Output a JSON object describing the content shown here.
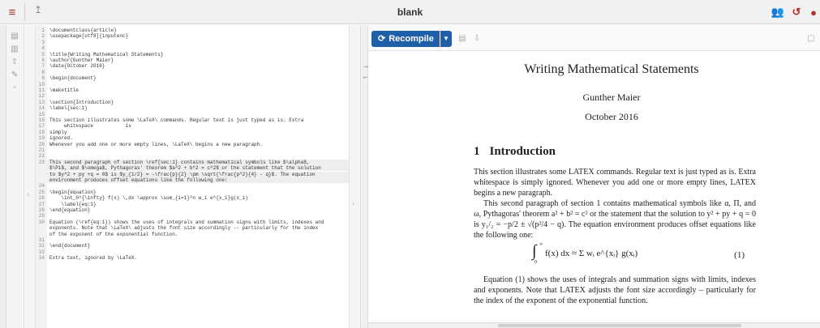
{
  "window": {
    "title": "blank"
  },
  "toolbar": {
    "recompile_label": "Recompile"
  },
  "editor": {
    "lines": [
      {
        "n": "1",
        "text": "\\documentclass{article}"
      },
      {
        "n": "2",
        "text": "\\usepackage[utf8]{inputenc}"
      },
      {
        "n": "3",
        "text": ""
      },
      {
        "n": "4",
        "text": ""
      },
      {
        "n": "5",
        "text": "\\title{Writing Mathematical Statements}"
      },
      {
        "n": "6",
        "text": "\\author{Gunther Maier}"
      },
      {
        "n": "7",
        "text": "\\date{October 2016}"
      },
      {
        "n": "8",
        "text": ""
      },
      {
        "n": "9",
        "text": "\\begin{document}"
      },
      {
        "n": "10",
        "text": ""
      },
      {
        "n": "11",
        "text": "\\maketitle"
      },
      {
        "n": "12",
        "text": ""
      },
      {
        "n": "13",
        "text": "\\section{Introduction}"
      },
      {
        "n": "14",
        "text": "\\label{sec:1}"
      },
      {
        "n": "15",
        "text": ""
      },
      {
        "n": "16",
        "text": "This section illustrates some \\LaTeX\\ commands. Regular text is just typed as is. Extra"
      },
      {
        "n": "17",
        "text": "     whitespace           is"
      },
      {
        "n": "18",
        "text": "simply"
      },
      {
        "n": "19",
        "text": "ignored."
      },
      {
        "n": "20",
        "text": "Whenever you add one or more empty lines, \\LaTeX\\ begins a new paragraph."
      },
      {
        "n": "21",
        "text": ""
      },
      {
        "n": "22",
        "text": ""
      },
      {
        "n": "23",
        "text": "This second paragraph of section \\ref{sec:1} contains mathematical symbols like $\\alpha$,"
      },
      {
        "n": "",
        "text": "$\\Pi$, and $\\omega$, Pythagoras' theorem $a^2 + b^2 = c^2$ or the statement that the solution"
      },
      {
        "n": "",
        "text": "to $y^2 + py +q = 0$ is $y_{1/2} = -\\frac{p}{2} \\pm \\sqrt{\\frac{p^2}{4} - q}$. The equation"
      },
      {
        "n": "",
        "text": "environment produces offset equations like the following one:"
      },
      {
        "n": "24",
        "text": ""
      },
      {
        "n": "25",
        "text": "\\begin{equation}"
      },
      {
        "n": "26",
        "text": "    \\int_0^{\\infty} f(x) \\,dx \\approx \\sum_{i=1}^n w_i e^{x_i}g(x_i)"
      },
      {
        "n": "27",
        "text": "    \\label{eq:1}"
      },
      {
        "n": "28",
        "text": "\\end{equation}"
      },
      {
        "n": "29",
        "text": ""
      },
      {
        "n": "30",
        "text": "Equation (\\ref{eq:1}) shows the uses of integrals and summation signs with limits, indexes and"
      },
      {
        "n": "",
        "text": "exponents. Note that \\LaTeX\\ adjusts the font size accordingly -- particularly for the index"
      },
      {
        "n": "",
        "text": "of the exponent of the exponential function."
      },
      {
        "n": "31",
        "text": ""
      },
      {
        "n": "32",
        "text": "\\end{document}"
      },
      {
        "n": "33",
        "text": ""
      },
      {
        "n": "34",
        "text": "Extra text, ignored by \\LaTeX."
      }
    ]
  },
  "pdf": {
    "title": "Writing Mathematical Statements",
    "author": "Gunther Maier",
    "date": "October 2016",
    "section_number": "1",
    "section_title": "Introduction",
    "para1": "This section illustrates some LATEX commands. Regular text is just typed as is. Extra whitespace is simply ignored. Whenever you add one or more empty lines, LATEX begins a new paragraph.",
    "para2": "This second paragraph of section 1 contains mathematical symbols like α, Π, and ω, Pythagoras' theorem a² + b² = c² or the statement that the solution to y² + py + q = 0 is y₁/₂ = −p/2 ± √(p²/4 − q). The equation environment produces offset equations like the following one:",
    "equation": "f(x) dx ≈ Σ wᵢ e^{xᵢ} g(xᵢ)",
    "equation_lower": "0",
    "equation_upper": "∞",
    "equation_number": "(1)",
    "para3": "Equation (1) shows the uses of integrals and summation signs with limits, indexes and exponents. Note that LATEX adjusts the font size accordingly – particularly for the index of the exponent of the exponential function."
  }
}
